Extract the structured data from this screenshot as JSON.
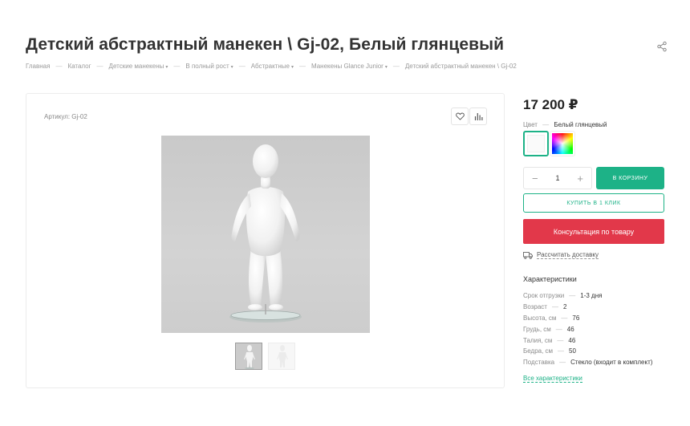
{
  "product": {
    "title": "Детский абстрактный манекен \\ Gj-02, Белый глянцевый",
    "sku_label": "Артикул: Gj-02"
  },
  "breadcrumbs": [
    {
      "label": "Главная",
      "has_caret": false
    },
    {
      "label": "Каталог",
      "has_caret": false
    },
    {
      "label": "Детские манекены",
      "has_caret": true
    },
    {
      "label": "В полный рост",
      "has_caret": true
    },
    {
      "label": "Абстрактные",
      "has_caret": true
    },
    {
      "label": "Манекены Glance Junior",
      "has_caret": true
    },
    {
      "label": "Детский абстрактный манекен \\ Gj-02",
      "has_caret": false
    }
  ],
  "breadcrumb_separator": "—",
  "breadcrumb_caret": "▾",
  "buy": {
    "price": "17 200 ₽",
    "color_label": "Цвет",
    "color_sep": "—",
    "color_value": "Белый глянцевый",
    "qty_minus": "−",
    "qty_value": "1",
    "qty_plus": "+",
    "cart_label": "В КОРЗИНУ",
    "one_click_label": "КУПИТЬ В 1 КЛИК",
    "consult_label": "Консультация по товару",
    "delivery_label": "Рассчитать доставку"
  },
  "specs": {
    "title": "Характеристики",
    "separator": "—",
    "rows": [
      {
        "name": "Срок отгрузки",
        "value": "1-3 дня"
      },
      {
        "name": "Возраст",
        "value": "2"
      },
      {
        "name": "Высота, см",
        "value": "76"
      },
      {
        "name": "Грудь, см",
        "value": "46"
      },
      {
        "name": "Талия, см",
        "value": "46"
      },
      {
        "name": "Бедра, см",
        "value": "50"
      },
      {
        "name": "Подставка",
        "value": "Стекло (входит в комплект)"
      }
    ],
    "all_link": "Все характеристики"
  },
  "icons": {
    "share": "share-icon",
    "favorite": "heart-icon",
    "compare": "compare-bars-icon",
    "delivery": "truck-icon"
  },
  "colors": {
    "accent": "#1db287",
    "consult": "#e2384a",
    "text": "#333333",
    "muted": "#8a8a8a"
  }
}
